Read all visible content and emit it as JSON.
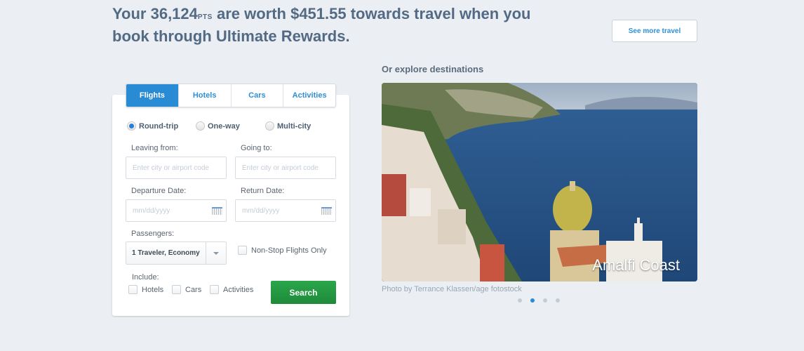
{
  "header": {
    "headline_prefix": "Your 36,124",
    "points_unit": "PTS",
    "headline_suffix": " are worth $451.55 towards travel when you book through Ultimate Rewards.",
    "see_more_label": "See more travel"
  },
  "search": {
    "tabs": [
      {
        "label": "Flights",
        "active": true
      },
      {
        "label": "Hotels",
        "active": false
      },
      {
        "label": "Cars",
        "active": false
      },
      {
        "label": "Activities",
        "active": false
      }
    ],
    "trip_types": [
      {
        "label": "Round-trip",
        "checked": true
      },
      {
        "label": "One-way",
        "checked": false
      },
      {
        "label": "Multi-city",
        "checked": false
      }
    ],
    "leaving_label": "Leaving from:",
    "leaving_placeholder": "Enter city or airport code",
    "going_label": "Going to:",
    "going_placeholder": "Enter city or airport code",
    "departure_label": "Departure Date:",
    "departure_placeholder": "mm/dd/yyyy",
    "return_label": "Return Date:",
    "return_placeholder": "mm/dd/yyyy",
    "passengers_label": "Passengers:",
    "passengers_value": "1 Traveler, Economy",
    "nonstop_label": "Non-Stop Flights Only",
    "include_label": "Include:",
    "include_options": [
      "Hotels",
      "Cars",
      "Activities"
    ],
    "search_label": "Search"
  },
  "destinations": {
    "title": "Or explore destinations",
    "caption": "Amalfi Coast",
    "credit": "Photo by Terrance Klassen/age fotostock",
    "slides_total": 4,
    "active_slide": 2
  },
  "colors": {
    "accent": "#2a8bd5",
    "search_green": "#23994a",
    "background": "#ebeff3"
  }
}
